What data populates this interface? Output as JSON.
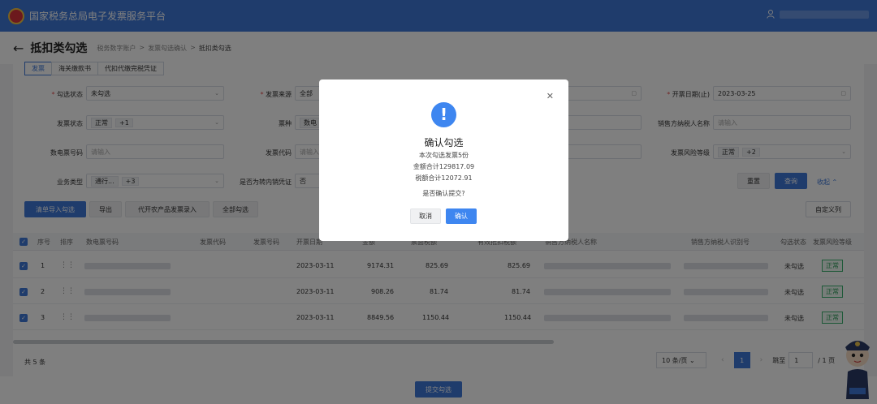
{
  "header": {
    "site_title": "国家税务总局电子发票服务平台"
  },
  "breadcrumb": {
    "back_glyph": "←",
    "page_title": "抵扣类勾选",
    "items": [
      "税务数字账户",
      "发票勾选确认",
      "抵扣类勾选"
    ],
    "sep": ">"
  },
  "tabs": [
    "发票",
    "海关缴款书",
    "代扣代缴完税凭证"
  ],
  "filters": {
    "check_status": {
      "label": "勾选状态",
      "value": "未勾选"
    },
    "invoice_source": {
      "label": "发票来源",
      "value": "全部"
    },
    "issue_date_end": {
      "label": "开票日期(止)",
      "value": "2023-03-25"
    },
    "invoice_status": {
      "label": "发票状态",
      "value": "正常",
      "extra": "+1"
    },
    "ticket_type": {
      "label": "票种",
      "value": "数电"
    },
    "seller_name": {
      "label": "销售方纳税人名称",
      "placeholder": "请输入"
    },
    "digital_invoice_no": {
      "label": "数电票号码",
      "placeholder": "请输入"
    },
    "invoice_code": {
      "label": "发票代码",
      "placeholder": "请输入"
    },
    "risk_level": {
      "label": "发票风险等级",
      "value": "正常",
      "extra": "+2"
    },
    "business_type": {
      "label": "业务类型",
      "value": "通行...",
      "extra": "+3"
    },
    "domestic_transfer": {
      "label": "是否为转内销凭证",
      "value": "否"
    }
  },
  "actions": {
    "reset": "重置",
    "query": "查询",
    "collapse": "收起",
    "import_list": "清单导入勾选",
    "export": "导出",
    "agri_entry": "代开农产品发票录入",
    "check_all": "全部勾选",
    "custom_columns": "自定义列",
    "submit": "提交勾选"
  },
  "table": {
    "headers": {
      "seq": "序号",
      "sort": "排序",
      "digital_no": "数电票号码",
      "inv_code": "发票代码",
      "inv_no": "发票号码",
      "issue_date": "开票日期",
      "amount": "金额",
      "tax": "票面税额",
      "valid_tax": "有效抵扣税额",
      "seller_name": "销售方纳税人名称",
      "seller_id": "销售方纳税人识别号",
      "check_status": "勾选状态",
      "risk_level": "发票风险等级"
    },
    "rows": [
      {
        "seq": "1",
        "date": "2023-03-11",
        "amount": "9174.31",
        "tax": "825.69",
        "valid_tax": "825.69",
        "status": "未勾选",
        "risk": "正常"
      },
      {
        "seq": "2",
        "date": "2023-03-11",
        "amount": "908.26",
        "tax": "81.74",
        "valid_tax": "81.74",
        "status": "未勾选",
        "risk": "正常"
      },
      {
        "seq": "3",
        "date": "2023-03-11",
        "amount": "8849.56",
        "tax": "1150.44",
        "valid_tax": "1150.44",
        "status": "未勾选",
        "risk": "正常"
      }
    ]
  },
  "pagination": {
    "total": "共 5 条",
    "page_size": "10 条/页",
    "current": "1",
    "goto_label": "跳至",
    "goto_value": "1",
    "pages": "/ 1 页"
  },
  "modal": {
    "title": "确认勾选",
    "count_line": "本次勾选发票5份",
    "amount_line": "金额合计129817.09",
    "tax_line": "税额合计12072.91",
    "question": "是否确认提交?",
    "cancel": "取消",
    "confirm": "确认"
  }
}
